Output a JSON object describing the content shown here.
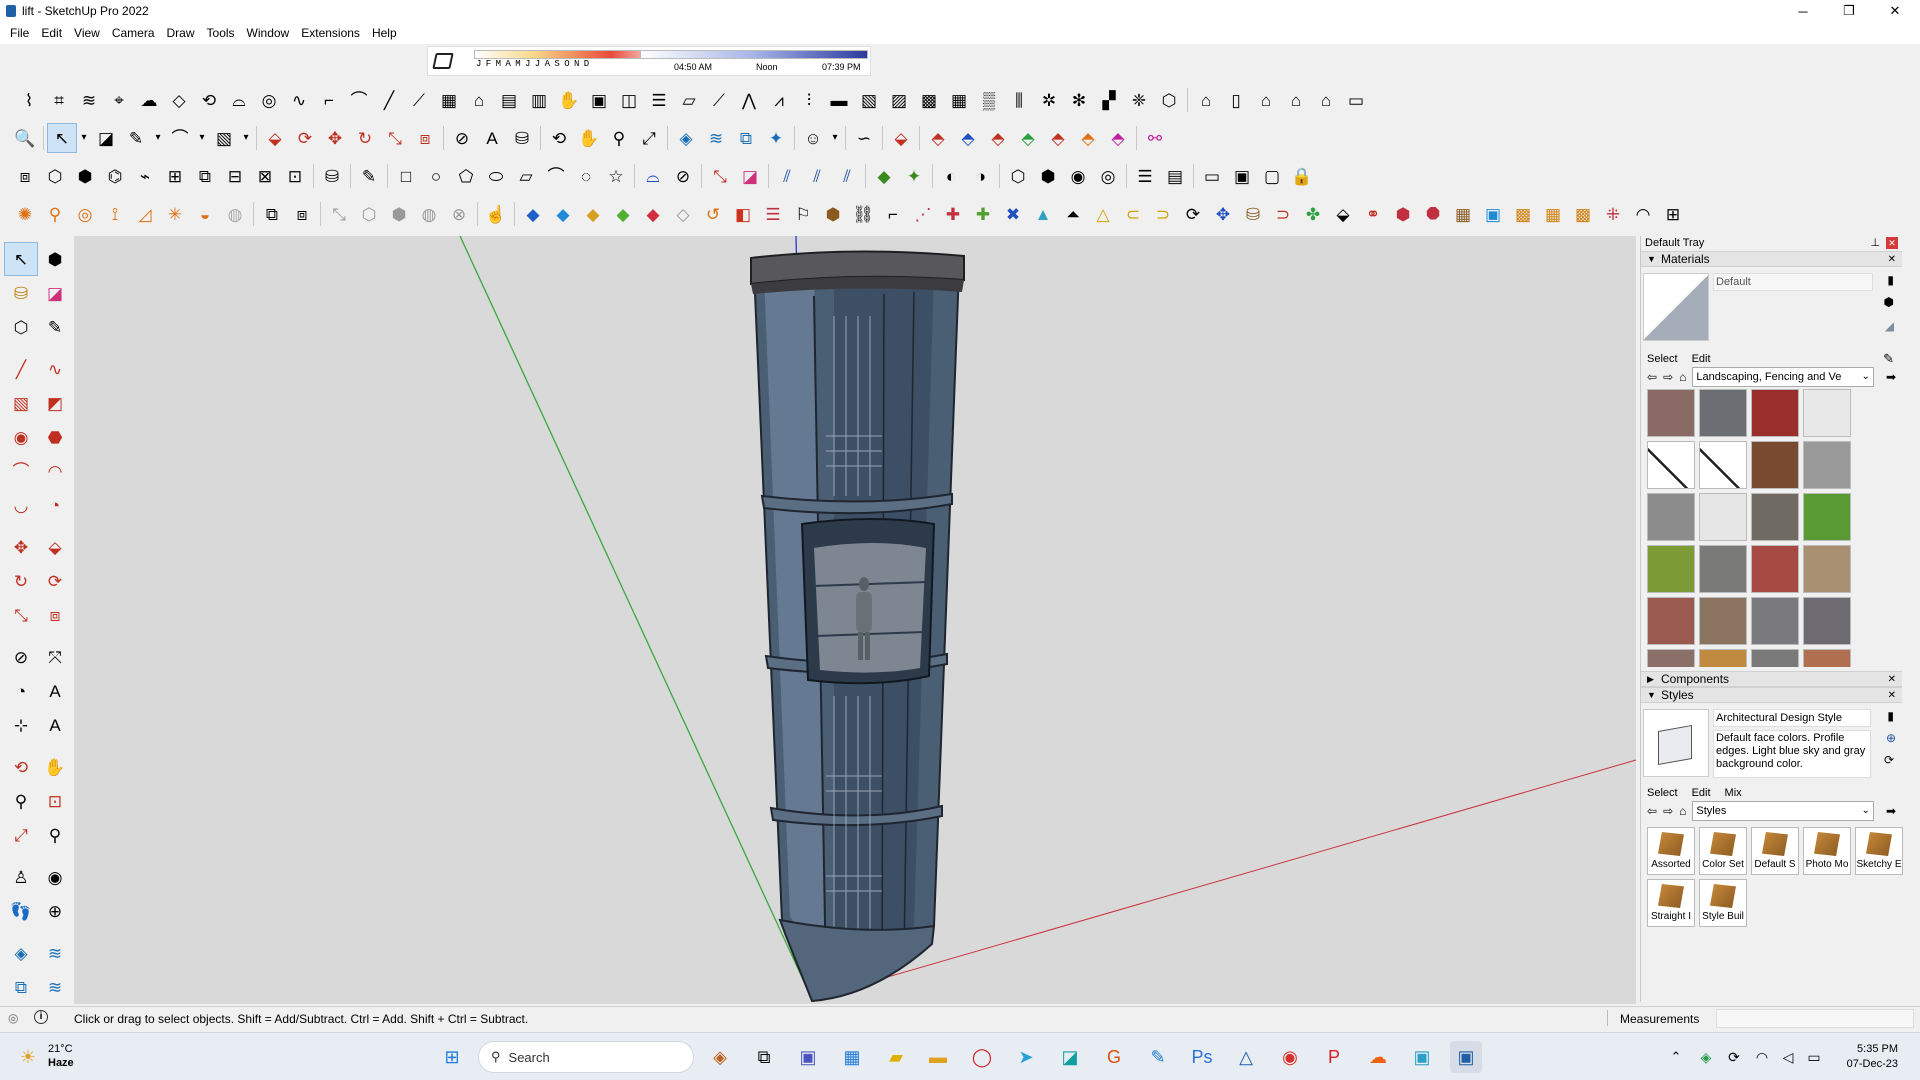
{
  "window": {
    "title": "lift - SketchUp Pro 2022",
    "minimize": "─",
    "maximize": "❐",
    "close": "✕"
  },
  "menu": [
    "File",
    "Edit",
    "View",
    "Camera",
    "Draw",
    "Tools",
    "Window",
    "Extensions",
    "Help"
  ],
  "shadows": {
    "month_letters": "JFMAMJJASOND",
    "time_start": "04:50 AM",
    "time_mid": "Noon",
    "time_end": "07:39 PM"
  },
  "tray": {
    "title": "Default Tray",
    "materials": {
      "header": "Materials",
      "current": "Default",
      "tabs": [
        "Select",
        "Edit"
      ],
      "collection": "Landscaping, Fencing and Ve",
      "swatch_colors": [
        "#8a6a64",
        "#6b6e72",
        "#9a2e2a",
        "#e8e8e8",
        "#ffffff",
        "#ffffff",
        "#7a4a30",
        "#9a9a9a",
        "#8c8c8c",
        "#e6e6e6",
        "#6f6a62",
        "#5a9a32",
        "#7c9a36",
        "#7a7a78",
        "#a84a44",
        "#a89070",
        "#9a5a50",
        "#8c7560",
        "#7a7a7e",
        "#6e6a72",
        "#8a7068",
        "#c08a40",
        "#7a7a7a",
        "#b07050"
      ]
    },
    "components": {
      "header": "Components"
    },
    "styles": {
      "header": "Styles",
      "name": "Architectural Design Style",
      "description": "Default face colors. Profile edges. Light blue sky and gray background color.",
      "tabs": [
        "Select",
        "Edit",
        "Mix"
      ],
      "collection": "Styles",
      "items": [
        "Assorted",
        "Color Set",
        "Default S",
        "Photo Mo",
        "Sketchy E",
        "Straight I",
        "Style Buil"
      ]
    }
  },
  "status": {
    "hint": "Click or drag to select objects. Shift = Add/Subtract. Ctrl = Add. Shift + Ctrl = Subtract.",
    "measurements_label": "Measurements"
  },
  "taskbar": {
    "weather_temp": "21°C",
    "weather_desc": "Haze",
    "search": "Search",
    "time": "5:35 PM",
    "date": "07-Dec-23"
  },
  "colors": {
    "axis_green": "#3aa83a",
    "axis_red": "#c8343c",
    "axis_blue": "#2a36c8",
    "viewport_bg": "#d9d9d9",
    "glass": "#3a4f66"
  }
}
